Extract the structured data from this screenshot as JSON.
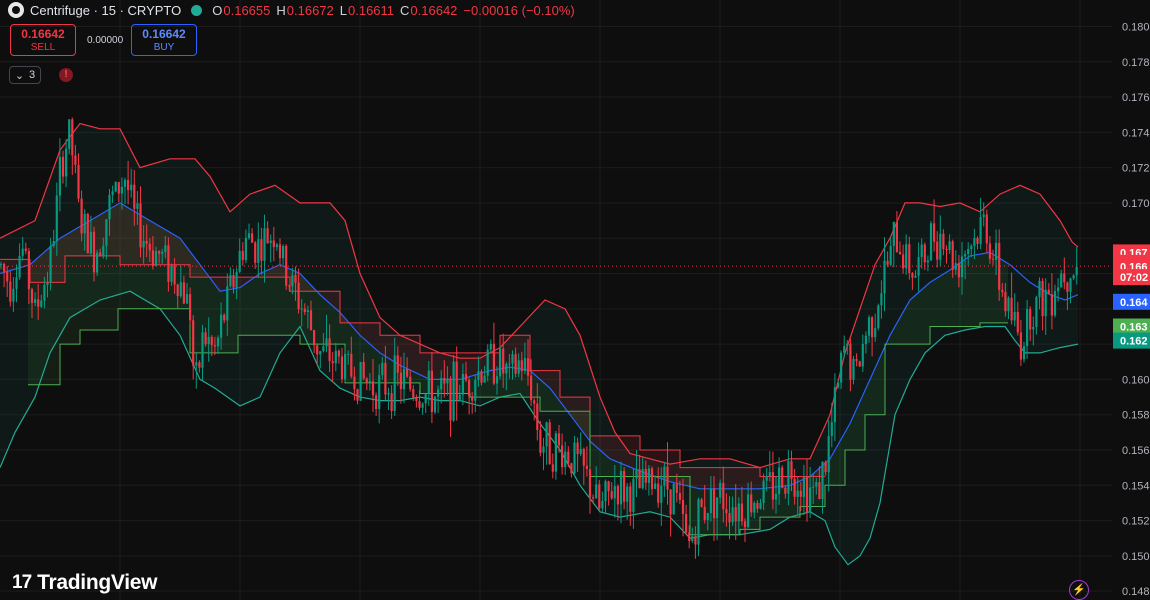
{
  "header": {
    "symbol": "Centrifuge · 15 · CRYPTO",
    "open_label": "O",
    "open": "0.16655",
    "high_label": "H",
    "high": "0.16672",
    "low_label": "L",
    "low": "0.16611",
    "close_label": "C",
    "close": "0.16642",
    "change": "−0.00016 (−0.10%)"
  },
  "trade": {
    "sell_price": "0.16642",
    "sell_label": "SELL",
    "spread": "0.00000",
    "buy_price": "0.16642",
    "buy_label": "BUY"
  },
  "indicators_count": "3",
  "brand": "TradingView",
  "colors": {
    "up": "#089981",
    "down": "#f23645",
    "basis": "#2962ff",
    "upper": "#f23645",
    "lower": "#22ab94",
    "stop": "#4caf50"
  },
  "chart_data": {
    "type": "candlestick",
    "ylim": [
      0.1475,
      0.1815
    ],
    "y_ticks": [
      "0.1800",
      "0.1780",
      "0.1760",
      "0.1740",
      "0.1720",
      "0.1700",
      "0.1600",
      "0.1580",
      "0.1560",
      "0.1540",
      "0.1520",
      "0.1500",
      "0.1480"
    ],
    "price_tags": [
      {
        "label": "0.167",
        "value": 0.1672,
        "color": "#f23645"
      },
      {
        "label": "0.166",
        "value": 0.1666,
        "color": "#f23645"
      },
      {
        "label": "0.166",
        "value": 0.1664,
        "color": "#f23645"
      },
      {
        "label": "07:02",
        "value": 0.1658,
        "color": "#f23645"
      },
      {
        "label": "0.164",
        "value": 0.1644,
        "color": "#2962ff"
      },
      {
        "label": "0.163",
        "value": 0.163,
        "color": "#4caf50"
      },
      {
        "label": "0.162",
        "value": 0.1622,
        "color": "#089981"
      }
    ],
    "last_price": 0.16642,
    "close_path": [
      [
        0,
        0.1665
      ],
      [
        10,
        0.1655
      ],
      [
        22,
        0.1675
      ],
      [
        35,
        0.1638
      ],
      [
        50,
        0.1665
      ],
      [
        62,
        0.1725
      ],
      [
        70,
        0.174
      ],
      [
        80,
        0.169
      ],
      [
        95,
        0.167
      ],
      [
        110,
        0.17
      ],
      [
        125,
        0.1715
      ],
      [
        135,
        0.169
      ],
      [
        150,
        0.1675
      ],
      [
        165,
        0.1668
      ],
      [
        180,
        0.1655
      ],
      [
        190,
        0.164
      ],
      [
        195,
        0.159
      ],
      [
        203,
        0.1625
      ],
      [
        215,
        0.1615
      ],
      [
        230,
        0.165
      ],
      [
        245,
        0.168
      ],
      [
        260,
        0.1675
      ],
      [
        275,
        0.1685
      ],
      [
        285,
        0.166
      ],
      [
        295,
        0.165
      ],
      [
        305,
        0.1638
      ],
      [
        320,
        0.1615
      ],
      [
        340,
        0.161
      ],
      [
        360,
        0.16
      ],
      [
        380,
        0.1596
      ],
      [
        400,
        0.16
      ],
      [
        420,
        0.1592
      ],
      [
        440,
        0.159
      ],
      [
        460,
        0.1596
      ],
      [
        480,
        0.1605
      ],
      [
        495,
        0.1612
      ],
      [
        510,
        0.16
      ],
      [
        520,
        0.161
      ],
      [
        530,
        0.16
      ],
      [
        540,
        0.1565
      ],
      [
        560,
        0.156
      ],
      [
        575,
        0.1555
      ],
      [
        590,
        0.154
      ],
      [
        600,
        0.1525
      ],
      [
        615,
        0.154
      ],
      [
        630,
        0.1535
      ],
      [
        645,
        0.154
      ],
      [
        660,
        0.1545
      ],
      [
        675,
        0.1535
      ],
      [
        688,
        0.1505
      ],
      [
        700,
        0.1525
      ],
      [
        715,
        0.1535
      ],
      [
        730,
        0.153
      ],
      [
        745,
        0.1528
      ],
      [
        760,
        0.1535
      ],
      [
        775,
        0.154
      ],
      [
        790,
        0.155
      ],
      [
        805,
        0.154
      ],
      [
        815,
        0.1535
      ],
      [
        825,
        0.155
      ],
      [
        835,
        0.1585
      ],
      [
        845,
        0.162
      ],
      [
        855,
        0.16
      ],
      [
        865,
        0.1625
      ],
      [
        875,
        0.164
      ],
      [
        885,
        0.166
      ],
      [
        895,
        0.168
      ],
      [
        905,
        0.167
      ],
      [
        915,
        0.166
      ],
      [
        925,
        0.167
      ],
      [
        935,
        0.1685
      ],
      [
        945,
        0.168
      ],
      [
        955,
        0.1665
      ],
      [
        965,
        0.1675
      ],
      [
        975,
        0.168
      ],
      [
        985,
        0.169
      ],
      [
        995,
        0.1665
      ],
      [
        1005,
        0.1645
      ],
      [
        1015,
        0.163
      ],
      [
        1022,
        0.162
      ],
      [
        1030,
        0.164
      ],
      [
        1040,
        0.1645
      ],
      [
        1050,
        0.165
      ],
      [
        1060,
        0.166
      ],
      [
        1070,
        0.1665
      ],
      [
        1078,
        0.16642
      ]
    ],
    "upper_band": [
      [
        0,
        0.168
      ],
      [
        35,
        0.169
      ],
      [
        60,
        0.173
      ],
      [
        80,
        0.1745
      ],
      [
        100,
        0.1742
      ],
      [
        120,
        0.1742
      ],
      [
        140,
        0.172
      ],
      [
        170,
        0.1725
      ],
      [
        195,
        0.1725
      ],
      [
        210,
        0.1715
      ],
      [
        230,
        0.1695
      ],
      [
        250,
        0.1705
      ],
      [
        275,
        0.171
      ],
      [
        300,
        0.17
      ],
      [
        330,
        0.17
      ],
      [
        345,
        0.169
      ],
      [
        360,
        0.166
      ],
      [
        380,
        0.1635
      ],
      [
        400,
        0.1625
      ],
      [
        420,
        0.162
      ],
      [
        440,
        0.1615
      ],
      [
        460,
        0.1612
      ],
      [
        480,
        0.1612
      ],
      [
        500,
        0.1618
      ],
      [
        520,
        0.163
      ],
      [
        545,
        0.1645
      ],
      [
        565,
        0.164
      ],
      [
        580,
        0.1625
      ],
      [
        600,
        0.159
      ],
      [
        615,
        0.157
      ],
      [
        630,
        0.1558
      ],
      [
        650,
        0.1555
      ],
      [
        670,
        0.1552
      ],
      [
        700,
        0.1555
      ],
      [
        730,
        0.1555
      ],
      [
        760,
        0.155
      ],
      [
        790,
        0.1555
      ],
      [
        810,
        0.1555
      ],
      [
        830,
        0.158
      ],
      [
        845,
        0.1615
      ],
      [
        860,
        0.164
      ],
      [
        875,
        0.1665
      ],
      [
        890,
        0.168
      ],
      [
        905,
        0.17
      ],
      [
        920,
        0.17
      ],
      [
        940,
        0.1698
      ],
      [
        960,
        0.17
      ],
      [
        980,
        0.1695
      ],
      [
        1000,
        0.1705
      ],
      [
        1020,
        0.171
      ],
      [
        1040,
        0.1705
      ],
      [
        1060,
        0.169
      ],
      [
        1072,
        0.1678
      ],
      [
        1078,
        0.1675
      ]
    ],
    "basis": [
      [
        0,
        0.166
      ],
      [
        30,
        0.1665
      ],
      [
        60,
        0.168
      ],
      [
        90,
        0.169
      ],
      [
        120,
        0.17
      ],
      [
        150,
        0.169
      ],
      [
        180,
        0.168
      ],
      [
        200,
        0.1665
      ],
      [
        220,
        0.165
      ],
      [
        240,
        0.1652
      ],
      [
        260,
        0.166
      ],
      [
        280,
        0.1665
      ],
      [
        300,
        0.166
      ],
      [
        320,
        0.1648
      ],
      [
        340,
        0.1638
      ],
      [
        360,
        0.1625
      ],
      [
        380,
        0.1615
      ],
      [
        400,
        0.1608
      ],
      [
        430,
        0.16
      ],
      [
        460,
        0.16
      ],
      [
        490,
        0.1605
      ],
      [
        510,
        0.1607
      ],
      [
        530,
        0.1605
      ],
      [
        550,
        0.1595
      ],
      [
        570,
        0.158
      ],
      [
        590,
        0.1565
      ],
      [
        610,
        0.1555
      ],
      [
        640,
        0.1548
      ],
      [
        670,
        0.1542
      ],
      [
        700,
        0.1538
      ],
      [
        730,
        0.1538
      ],
      [
        760,
        0.1538
      ],
      [
        790,
        0.154
      ],
      [
        810,
        0.1545
      ],
      [
        830,
        0.1555
      ],
      [
        850,
        0.1575
      ],
      [
        870,
        0.16
      ],
      [
        890,
        0.1625
      ],
      [
        910,
        0.1645
      ],
      [
        930,
        0.1655
      ],
      [
        950,
        0.1662
      ],
      [
        970,
        0.167
      ],
      [
        990,
        0.1672
      ],
      [
        1010,
        0.1665
      ],
      [
        1030,
        0.1655
      ],
      [
        1050,
        0.1648
      ],
      [
        1065,
        0.1645
      ],
      [
        1078,
        0.1648
      ]
    ],
    "lower_band": [
      [
        0,
        0.155
      ],
      [
        15,
        0.157
      ],
      [
        35,
        0.159
      ],
      [
        50,
        0.1615
      ],
      [
        70,
        0.1635
      ],
      [
        100,
        0.1645
      ],
      [
        130,
        0.165
      ],
      [
        160,
        0.164
      ],
      [
        180,
        0.1625
      ],
      [
        200,
        0.16
      ],
      [
        215,
        0.1595
      ],
      [
        240,
        0.1585
      ],
      [
        260,
        0.159
      ],
      [
        280,
        0.1615
      ],
      [
        300,
        0.163
      ],
      [
        320,
        0.1605
      ],
      [
        340,
        0.1595
      ],
      [
        360,
        0.159
      ],
      [
        380,
        0.1588
      ],
      [
        400,
        0.1588
      ],
      [
        420,
        0.159
      ],
      [
        440,
        0.1588
      ],
      [
        460,
        0.1588
      ],
      [
        480,
        0.1585
      ],
      [
        500,
        0.159
      ],
      [
        520,
        0.1592
      ],
      [
        540,
        0.1575
      ],
      [
        560,
        0.156
      ],
      [
        580,
        0.154
      ],
      [
        600,
        0.1525
      ],
      [
        620,
        0.1522
      ],
      [
        650,
        0.1525
      ],
      [
        670,
        0.1522
      ],
      [
        690,
        0.151
      ],
      [
        710,
        0.1512
      ],
      [
        740,
        0.1512
      ],
      [
        770,
        0.1515
      ],
      [
        790,
        0.1522
      ],
      [
        810,
        0.1525
      ],
      [
        825,
        0.152
      ],
      [
        835,
        0.1505
      ],
      [
        848,
        0.1495
      ],
      [
        860,
        0.15
      ],
      [
        870,
        0.151
      ],
      [
        880,
        0.153
      ],
      [
        895,
        0.158
      ],
      [
        910,
        0.16
      ],
      [
        925,
        0.1615
      ],
      [
        945,
        0.1625
      ],
      [
        965,
        0.1628
      ],
      [
        985,
        0.163
      ],
      [
        1005,
        0.163
      ],
      [
        1015,
        0.1622
      ],
      [
        1025,
        0.1615
      ],
      [
        1040,
        0.1615
      ],
      [
        1060,
        0.1618
      ],
      [
        1078,
        0.162
      ]
    ],
    "stop_upper": [
      [
        0,
        0.1668
      ],
      [
        30,
        0.1668
      ],
      [
        30,
        0.1655
      ],
      [
        65,
        0.1655
      ],
      [
        65,
        0.167
      ],
      [
        120,
        0.167
      ],
      [
        120,
        0.1665
      ],
      [
        190,
        0.1665
      ],
      [
        190,
        0.1658
      ],
      [
        290,
        0.1658
      ],
      [
        290,
        0.165
      ],
      [
        340,
        0.165
      ],
      [
        340,
        0.1632
      ],
      [
        380,
        0.1632
      ],
      [
        380,
        0.1625
      ],
      [
        420,
        0.1625
      ],
      [
        420,
        0.1615
      ],
      [
        500,
        0.1615
      ],
      [
        500,
        0.1625
      ],
      [
        530,
        0.1625
      ],
      [
        530,
        0.1605
      ],
      [
        560,
        0.1605
      ],
      [
        560,
        0.159
      ],
      [
        590,
        0.159
      ],
      [
        590,
        0.1568
      ],
      [
        640,
        0.1568
      ],
      [
        640,
        0.156
      ],
      [
        680,
        0.156
      ],
      [
        680,
        0.155
      ],
      [
        760,
        0.155
      ],
      [
        760,
        0.1545
      ],
      [
        825,
        0.1545
      ]
    ],
    "stop_lower": [
      [
        28,
        0.1597
      ],
      [
        60,
        0.1597
      ],
      [
        60,
        0.162
      ],
      [
        80,
        0.162
      ],
      [
        80,
        0.1628
      ],
      [
        118,
        0.1628
      ],
      [
        118,
        0.164
      ],
      [
        190,
        0.164
      ],
      [
        190,
        0.1615
      ],
      [
        238,
        0.1615
      ],
      [
        238,
        0.1625
      ],
      [
        300,
        0.1625
      ],
      [
        300,
        0.162
      ],
      [
        345,
        0.162
      ],
      [
        345,
        0.1598
      ],
      [
        420,
        0.1598
      ],
      [
        420,
        0.1592
      ],
      [
        470,
        0.1592
      ],
      [
        470,
        0.159
      ],
      [
        540,
        0.159
      ],
      [
        540,
        0.1582
      ],
      [
        590,
        0.1582
      ],
      [
        590,
        0.1545
      ],
      [
        690,
        0.1545
      ],
      [
        690,
        0.1512
      ],
      [
        740,
        0.1512
      ],
      [
        740,
        0.1515
      ],
      [
        760,
        0.1515
      ],
      [
        760,
        0.1522
      ],
      [
        800,
        0.1522
      ],
      [
        800,
        0.1528
      ],
      [
        825,
        0.1528
      ],
      [
        825,
        0.154
      ],
      [
        845,
        0.154
      ],
      [
        845,
        0.156
      ],
      [
        865,
        0.156
      ],
      [
        865,
        0.158
      ],
      [
        885,
        0.158
      ],
      [
        885,
        0.162
      ],
      [
        930,
        0.162
      ],
      [
        930,
        0.163
      ],
      [
        980,
        0.163
      ],
      [
        980,
        0.1632
      ],
      [
        1008,
        0.1632
      ]
    ]
  }
}
